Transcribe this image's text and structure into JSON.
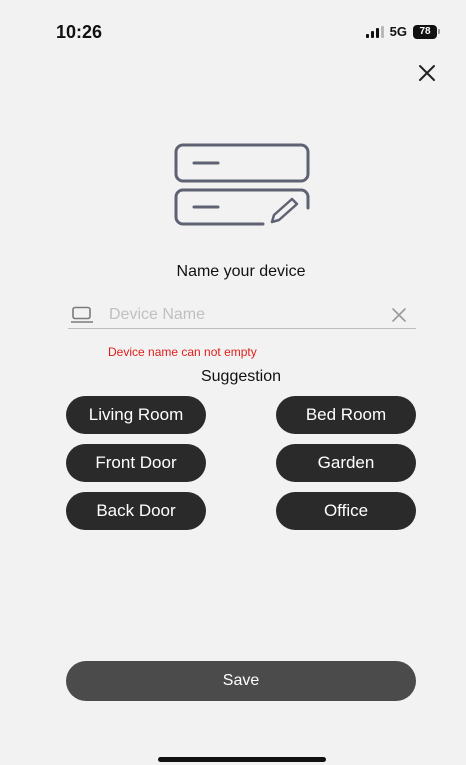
{
  "status_bar": {
    "time": "10:26",
    "network": "5G",
    "battery": "78"
  },
  "icons": {
    "close": "close-icon",
    "illustration": "device-rename-illustration",
    "input": "device-icon",
    "clear": "clear-icon"
  },
  "dialog": {
    "title": "Name your device",
    "input_placeholder": "Device Name",
    "input_value": "",
    "error": "Device name can not empty",
    "suggestion_label": "Suggestion",
    "suggestions": [
      "Living Room",
      "Bed Room",
      "Front Door",
      "Garden",
      "Back Door",
      "Office"
    ],
    "save_label": "Save"
  },
  "colors": {
    "background": "#f2f2f2",
    "chip": "#2a2a2a",
    "save_button": "#4b4b4b",
    "error": "#e0201d"
  }
}
